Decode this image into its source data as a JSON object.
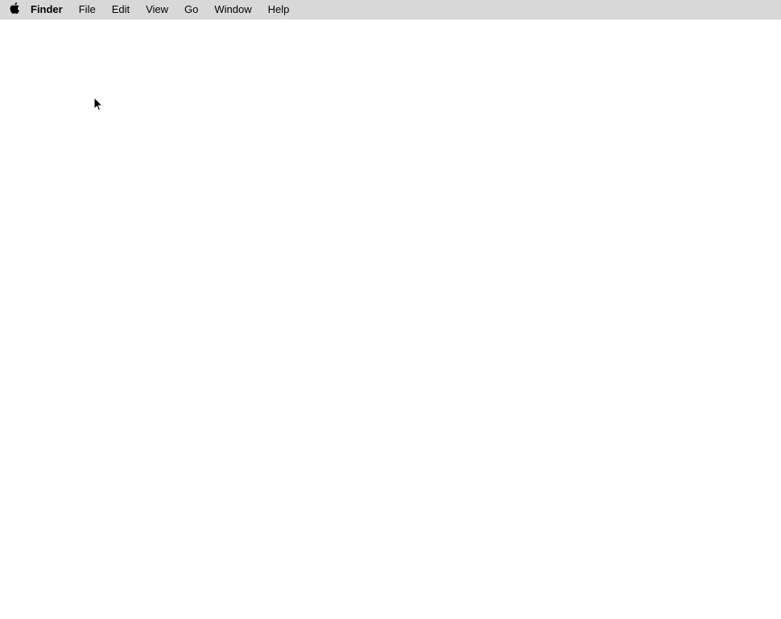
{
  "menubar": {
    "app_name": "Finder",
    "items": [
      {
        "label": "File"
      },
      {
        "label": "Edit"
      },
      {
        "label": "View"
      },
      {
        "label": "Go"
      },
      {
        "label": "Window"
      },
      {
        "label": "Help"
      }
    ]
  }
}
